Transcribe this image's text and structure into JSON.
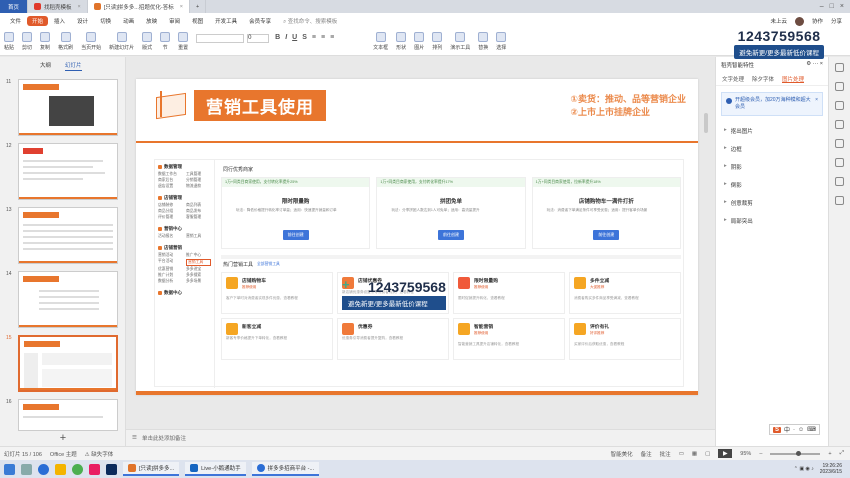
{
  "tabs": [
    {
      "label": "首页",
      "kind": "home"
    },
    {
      "label": "找稻壳模板",
      "color": "#e0392b"
    },
    {
      "label": "[只读]拼多多...招题优化-答标",
      "color": "#e0742b",
      "active": true
    }
  ],
  "menubar": {
    "items": [
      "文件",
      "开始",
      "插入",
      "设计",
      "切换",
      "动画",
      "放映",
      "审阅",
      "视图",
      "开发工具",
      "会员专享"
    ],
    "active": "开始",
    "search": "查找命令、搜索模板",
    "right": [
      "未上云",
      "协作",
      "分享"
    ]
  },
  "ribbon": {
    "buttons": [
      "粘贴",
      "剪切",
      "复制",
      "格式刷",
      "当页开始",
      "新建幻灯片",
      "版式",
      "节",
      "重置"
    ],
    "font_name": "",
    "font_size": "0",
    "right_buttons": [
      "文本框",
      "形状",
      "图片",
      "排列",
      "演示工具",
      "替换",
      "选择"
    ]
  },
  "watermark": {
    "number": "1243759568",
    "subtitle": "避免新更/更多最新低价课程"
  },
  "thumb_panel": {
    "tabs": [
      "大纲",
      "幻灯片"
    ],
    "active_tab": "幻灯片",
    "slides": [
      "11",
      "12",
      "13",
      "14",
      "15",
      "16"
    ],
    "selected": "15"
  },
  "slide": {
    "title": "营销工具使用",
    "right_lines": [
      "①卖货：推动、品等营销企业",
      "②上市上市挂牌企业"
    ],
    "left_nav": [
      {
        "head": "数据管理",
        "items": [
          "数据工作台",
          "工具管理",
          "商家后台",
          "分销管理",
          "退店设置",
          "物流退款"
        ]
      },
      {
        "head": "店铺管理",
        "items": [
          "店铺装修",
          "商品列表",
          "商品分组",
          "商品发布",
          "评价管理",
          "客服管理"
        ]
      },
      {
        "head": "营销中心",
        "items": [
          "活动报名",
          "营销工具"
        ]
      },
      {
        "head": "店铺营销",
        "items": [
          "营销活动",
          "推广中心",
          "平台活动",
          "营销工具",
          "优惠营销",
          "多多进宝",
          "推广计划",
          "多多搜索",
          "数据分析",
          "多多场景"
        ]
      },
      {
        "head": "数据中心",
        "items": []
      }
    ],
    "highlight_nav": "营销工具",
    "promo_title": "同行优秀商家",
    "promos": [
      {
        "top": "1万+同类目商家使用，支付转化率提升25%",
        "name": "限时限量购",
        "desc": "玩法：降低价格提升转化率订单量；适用：快速提升销量和订单",
        "btn": "前往创建"
      },
      {
        "top": "1万+同类目商家使用，支付转化率提升17%",
        "name": "拼团免单",
        "desc": "玩法：分享拼团人数达到1人可免单；适用：高流量提升",
        "btn": "前往创建"
      },
      {
        "top": "1万+同类目商家使用，拉新率提升18%",
        "name": "店铺购物车一满件打折",
        "desc": "玩法：消费者下单满足条件可享受优惠；适用：提升客单价场景",
        "btn": "前往创建"
      }
    ],
    "tools_title": "热门营销工具",
    "tools_sub": "全部营销工具",
    "tools": [
      {
        "name": "店铺购物车",
        "tag": "推荐使用",
        "desc": "客户下单时对消费者实现多件优惠，查看教程"
      },
      {
        "name": "店铺优惠券",
        "tag": "",
        "desc": "新店铺优惠券设置引导消费者购买，查看教程"
      },
      {
        "name": "限时限量购",
        "tag": "推荐使用",
        "desc": "限时促销提升转化，查看教程"
      },
      {
        "name": "多件立减",
        "tag": "大促推荐",
        "desc": "消费者购买多件商品享受满减，查看教程"
      },
      {
        "name": "新客立减",
        "tag": "",
        "desc": "新客专享价格提升下单转化，查看教程"
      },
      {
        "name": "优惠券",
        "tag": "",
        "desc": "优惠券引导消费者提升复购，查看教程"
      },
      {
        "name": "智能营销",
        "tag": "推荐使用",
        "desc": "智能营销工具提升店铺转化，查看教程"
      },
      {
        "name": "评价有礼",
        "tag": "好评推荐",
        "desc": "买家评价后获取优惠，查看教程"
      }
    ]
  },
  "notes_placeholder": "单击此处添加备注",
  "right_panel": {
    "header": "稻壳智能特性",
    "tabs": [
      "文字处理",
      "除夕字体",
      "图片处理"
    ],
    "active_tab": "图片处理",
    "notice": "开超级会员，加20万海种模和超大会员",
    "items": [
      "抠出图片",
      "边框",
      "阴影",
      "倒影",
      "创意裁剪",
      "局部突出"
    ]
  },
  "statusbar": {
    "slide_info": "幻灯片 15 / 106",
    "theme": "Office 主题",
    "missing_font": "缺失字体",
    "smart_beautify": "智能美化",
    "notes": "备注",
    "comments": "批注",
    "zoom": "95%"
  },
  "taskbar": {
    "apps": [
      "[只读]拼多多...",
      "Live-小鹅通助手",
      "拼多多招商平台 -..."
    ],
    "time": "19:26:26",
    "date": "2023/6/15"
  },
  "ime": {
    "items": [
      "S",
      "中",
      "·",
      "☺",
      "⌨"
    ]
  }
}
